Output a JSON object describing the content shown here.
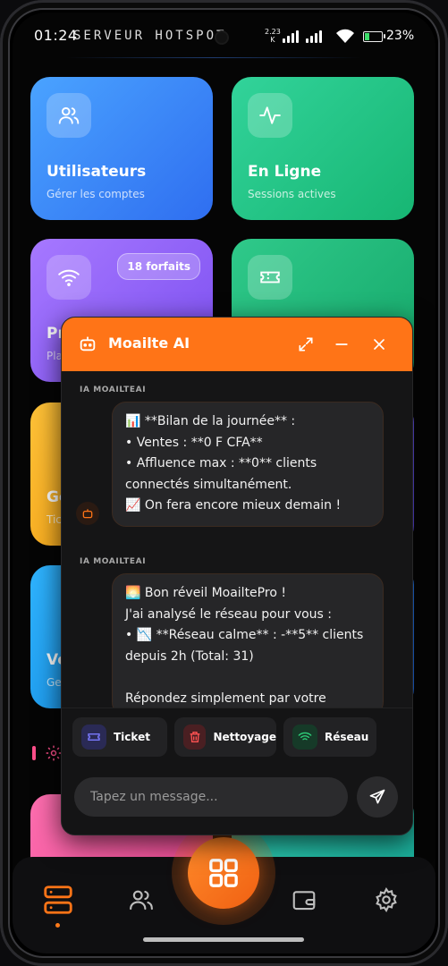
{
  "status_bar": {
    "time": "01:24",
    "ghost_title": "SERVEUR HOTSPOT",
    "net_speed": "2.23",
    "net_unit": "K",
    "battery_pct": "23%"
  },
  "cards": {
    "users": {
      "title": "Utilisateurs",
      "subtitle": "Gérer les comptes",
      "icon": "users-icon"
    },
    "online": {
      "title": "En Ligne",
      "subtitle": "Sessions actives",
      "icon": "activity-icon"
    },
    "plans": {
      "title": "Pr",
      "subtitle": "Pla",
      "badge": "18 forfaits",
      "icon": "wifi-icon"
    },
    "tickets": {
      "icon": "ticket-icon"
    },
    "gest": {
      "title": "Ge",
      "subtitle": "Tic"
    },
    "ventes": {
      "title": "Ve",
      "subtitle": "Ge"
    }
  },
  "chat": {
    "title": "Moailte AI",
    "messages": [
      {
        "sender": "IA MOAILTEAI",
        "lines": [
          "📊 **Bilan de la journée** :",
          "• Ventes : **0 F CFA**",
          "• Affluence max : **0** clients",
          "connectés simultanément.",
          "📈 On fera encore mieux demain !"
        ]
      },
      {
        "sender": "IA MOAILTEAI",
        "lines": [
          "🌅 Bon réveil MoailtePro !",
          "J'ai analysé le réseau pour vous :",
          "• 📉 **Réseau calme** : -**5** clients",
          "depuis 2h (Total: 31)",
          "",
          "Répondez simplement par votre"
        ]
      }
    ],
    "quick_actions": [
      {
        "label": "Ticket",
        "icon": "ticket-icon",
        "color": "#5b5bff"
      },
      {
        "label": "Nettoyage",
        "icon": "trash-icon",
        "color": "#ff4d4d"
      },
      {
        "label": "Réseau",
        "icon": "wifi-icon",
        "color": "#2fd07a"
      }
    ],
    "input_placeholder": "Tapez un message..."
  },
  "bottom_nav": {
    "items": [
      "server-icon",
      "users-icon",
      "grid-icon",
      "wallet-icon",
      "gear-icon"
    ],
    "active": "server-icon",
    "accent": "#ff7417"
  }
}
